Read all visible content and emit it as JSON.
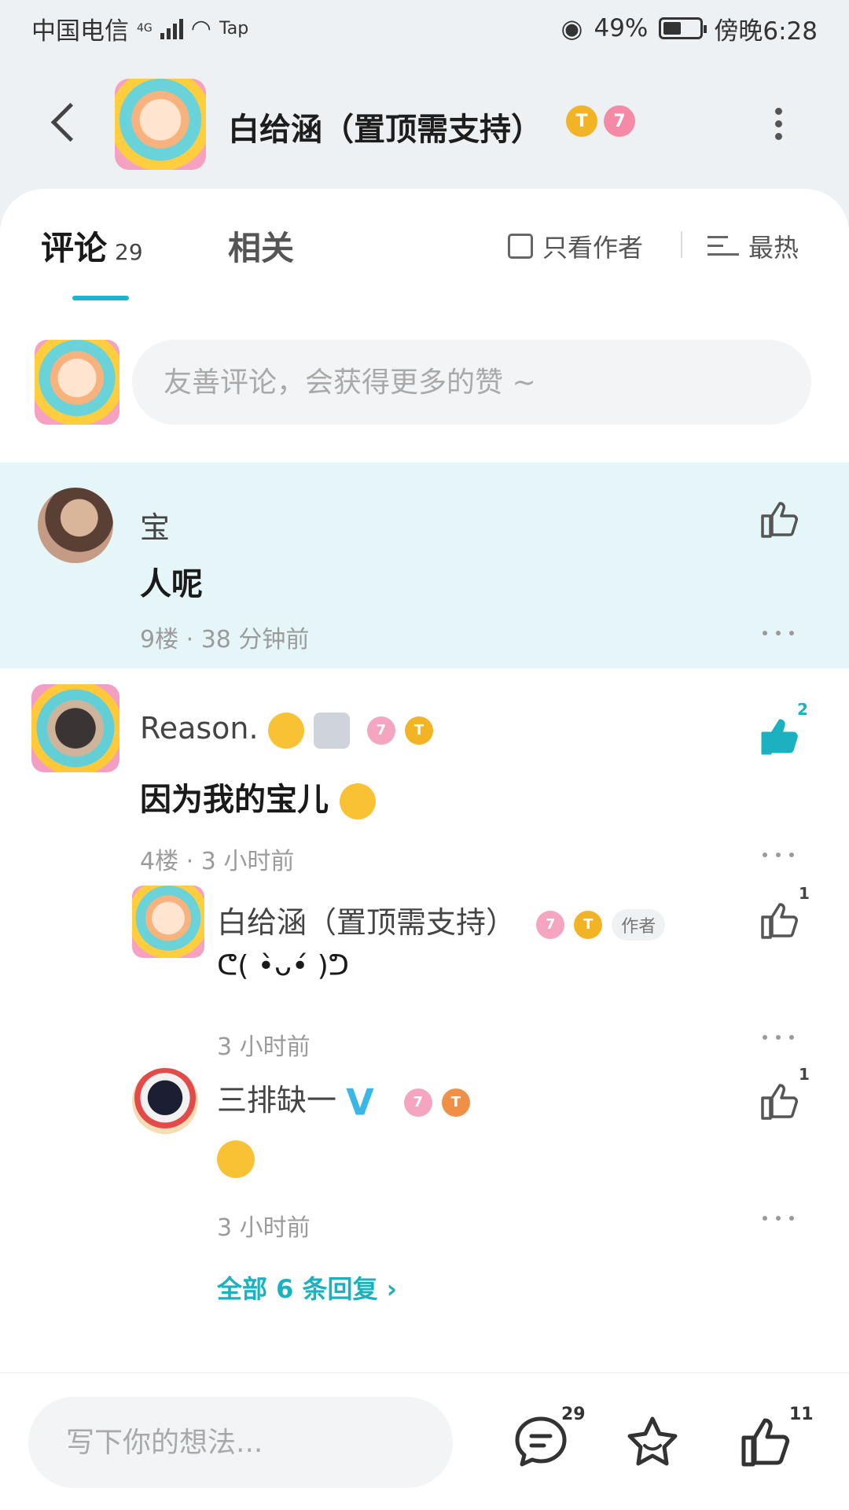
{
  "status": {
    "carrier": "中国电信",
    "network": "4G",
    "app": "Tap",
    "battery": "49%",
    "battery_level": 0.49,
    "time": "傍晚6:28"
  },
  "header": {
    "title": "白给涵（置顶需支持）",
    "badges": [
      "T",
      "7"
    ]
  },
  "tabs": {
    "comments_label": "评论",
    "comments_count": "29",
    "related_label": "相关",
    "only_author_label": "只看作者",
    "sort_label": "最热"
  },
  "composer": {
    "placeholder": "友善评论，会获得更多的赞 ~"
  },
  "comments": [
    {
      "username": "宝",
      "text": "人呢",
      "meta": "9楼 · 38 分钟前",
      "like_count": ""
    },
    {
      "username": "Reason.",
      "text": "因为我的宝儿",
      "meta": "4楼 · 3 小时前",
      "like_count": "2",
      "liked": true,
      "badges": [
        "7",
        "T"
      ],
      "replies": [
        {
          "username": "白给涵（置顶需支持）",
          "author_tag": "作者",
          "text": "ᕦ( •̀ᴗ•́ )ᕤ",
          "meta": "3 小时前",
          "like_count": "1",
          "badges": [
            "7",
            "T"
          ]
        },
        {
          "username": "三排缺一",
          "verified": "V",
          "text": "",
          "meta": "3 小时前",
          "like_count": "1",
          "badges": [
            "7",
            "T"
          ]
        }
      ],
      "more_replies_label": "全部 6 条回复 ›"
    }
  ],
  "bottombar": {
    "placeholder": "写下你的想法...",
    "comment_count": "29",
    "like_count": "11"
  },
  "colors": {
    "accent": "#1ab8c6",
    "highlight_bg": "#e6f6f8",
    "liked": "#1ab1c0"
  }
}
